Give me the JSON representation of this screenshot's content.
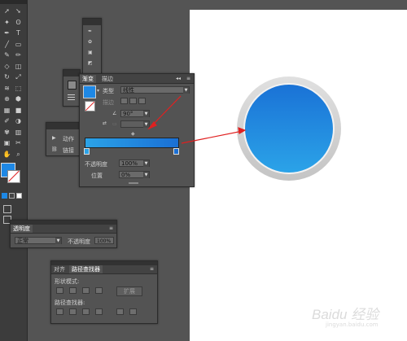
{
  "colors": {
    "accent": "#1e88e5",
    "arrow": "#e02020"
  },
  "tools": {
    "items": [
      "selection-tool",
      "direct-selection-tool",
      "magic-wand-tool",
      "lasso-tool",
      "pen-tool",
      "type-tool",
      "line-tool",
      "rectangle-tool",
      "paintbrush-tool",
      "pencil-tool",
      "shaper-tool",
      "eraser-tool",
      "rotate-tool",
      "scale-tool",
      "width-tool",
      "free-transform-tool",
      "shape-builder-tool",
      "perspective-tool",
      "mesh-tool",
      "gradient-tool",
      "eyedropper-tool",
      "blend-tool",
      "symbol-sprayer-tool",
      "graph-tool",
      "artboard-tool",
      "slice-tool",
      "hand-tool",
      "zoom-tool"
    ]
  },
  "gradient_panel": {
    "tab_gradient": "渐变",
    "tab_stroke": "描边",
    "type_label": "类型",
    "type_value": "线性",
    "stroke_label": "描边",
    "angle_value": "90°",
    "opacity_label": "不透明度",
    "opacity_value": "100%",
    "location_label": "位置",
    "location_value": "0%"
  },
  "actions_panel": {
    "actions_label": "动作",
    "links_label": "链接"
  },
  "transparency_panel": {
    "title": "透明度",
    "mode_value": "正常",
    "opacity_label": "不透明度",
    "opacity_value": "100%"
  },
  "pathfinder_panel": {
    "tab_align": "对齐",
    "tab_pathfinder": "路径查找器",
    "shape_modes_label": "形状模式:",
    "expand_label": "扩展",
    "pathfinders_label": "路径查找器:"
  },
  "watermark": "Baidu 经验",
  "watermark_sub": "jingyan.baidu.com"
}
